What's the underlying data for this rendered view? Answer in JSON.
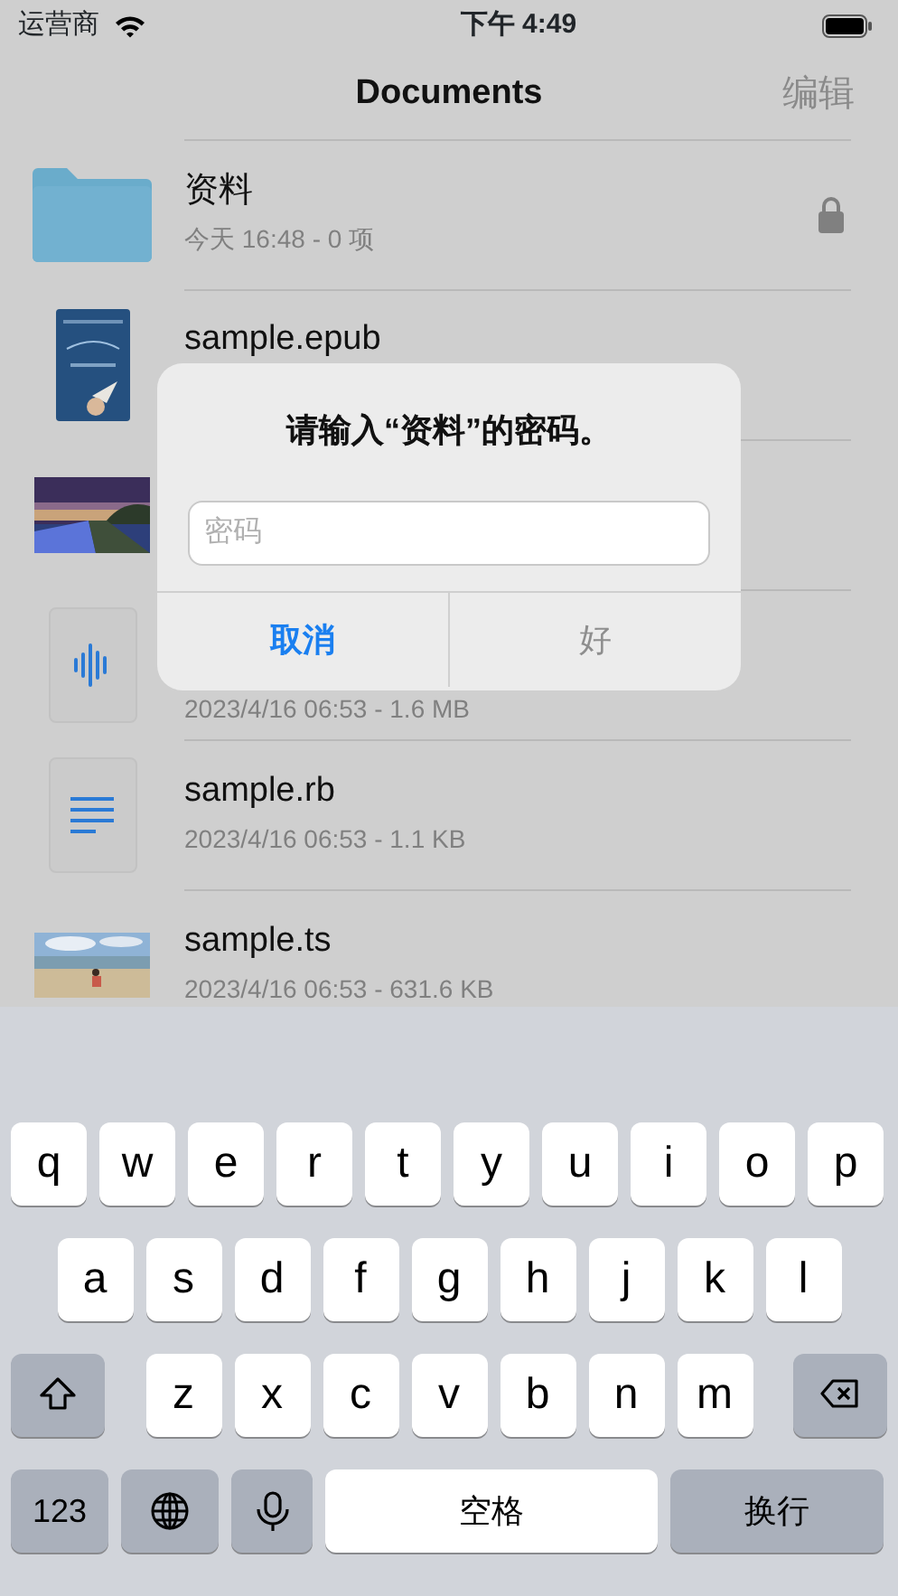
{
  "status_bar": {
    "carrier": "运营商",
    "time": "下午 4:49"
  },
  "nav": {
    "title": "Documents",
    "edit": "编辑"
  },
  "files": [
    {
      "kind": "folder",
      "name": "资料",
      "detail": "今天 16:48 - 0 项",
      "locked": true
    },
    {
      "kind": "book",
      "name": "sample.epub",
      "locked": false
    },
    {
      "kind": "landscape",
      "locked": false
    },
    {
      "kind": "audio",
      "detail": "2023/4/16 06:53 - 1.6 MB",
      "locked": false
    },
    {
      "kind": "text",
      "name": "sample.rb",
      "detail": "2023/4/16 06:53 - 1.1 KB",
      "locked": false
    },
    {
      "kind": "beach",
      "name": "sample.ts",
      "detail": "2023/4/16 06:53 - 631.6 KB",
      "locked": false
    }
  ],
  "dialog": {
    "title": "请输入“资料”的密码。",
    "placeholder": "密码",
    "buttons": [
      {
        "label": "取消",
        "disabled": false
      },
      {
        "label": "好",
        "disabled": true
      }
    ]
  },
  "keyboard": {
    "rows": [
      {
        "keys": [
          {
            "kind": "letter",
            "label": "q"
          },
          {
            "kind": "letter",
            "label": "w"
          },
          {
            "kind": "letter",
            "label": "e"
          },
          {
            "kind": "letter",
            "label": "r"
          },
          {
            "kind": "letter",
            "label": "t"
          },
          {
            "kind": "letter",
            "label": "y"
          },
          {
            "kind": "letter",
            "label": "u"
          },
          {
            "kind": "letter",
            "label": "i"
          },
          {
            "kind": "letter",
            "label": "o"
          },
          {
            "kind": "letter",
            "label": "p"
          }
        ]
      },
      {
        "keys": [
          {
            "kind": "letter",
            "label": "a"
          },
          {
            "kind": "letter",
            "label": "s"
          },
          {
            "kind": "letter",
            "label": "d"
          },
          {
            "kind": "letter",
            "label": "f"
          },
          {
            "kind": "letter",
            "label": "g"
          },
          {
            "kind": "letter",
            "label": "h"
          },
          {
            "kind": "letter",
            "label": "j"
          },
          {
            "kind": "letter",
            "label": "k"
          },
          {
            "kind": "letter",
            "label": "l"
          }
        ]
      },
      {
        "keys": [
          {
            "kind": "shift"
          },
          {
            "kind": "letter",
            "label": "z"
          },
          {
            "kind": "letter",
            "label": "x"
          },
          {
            "kind": "letter",
            "label": "c"
          },
          {
            "kind": "letter",
            "label": "v"
          },
          {
            "kind": "letter",
            "label": "b"
          },
          {
            "kind": "letter",
            "label": "n"
          },
          {
            "kind": "letter",
            "label": "m"
          },
          {
            "kind": "delete"
          }
        ]
      },
      {
        "keys": [
          {
            "kind": "numbers",
            "label": "123"
          },
          {
            "kind": "globe"
          },
          {
            "kind": "mic"
          },
          {
            "kind": "space",
            "label": "空格"
          },
          {
            "kind": "return",
            "label": "换行"
          }
        ]
      }
    ]
  }
}
